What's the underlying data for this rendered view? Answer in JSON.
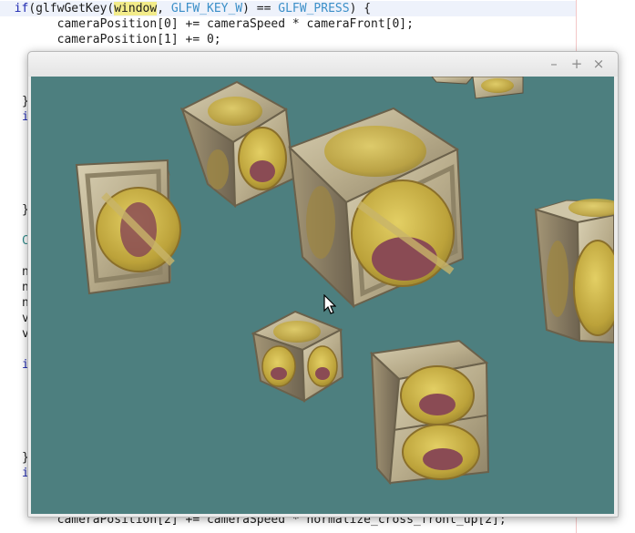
{
  "code": {
    "line1_if": "if",
    "line1_a": "(glfwGetKey(",
    "line1_window": "window",
    "line1_comma": ", ",
    "line1_macro1": "GLFW_KEY_W",
    "line1_eq": ") == ",
    "line1_macro2": "GLFW_PRESS",
    "line1_end": ") {",
    "line2": "cameraPosition[0] += cameraSpeed * cameraFront[0];",
    "line3": "cameraPosition[1] += 0;",
    "last_line": "cameraPosition[2] += cameraSpeed * normalize_cross_front_up[2];",
    "stubs": {
      "s1": "}",
      "s2": "i",
      "s3": "}",
      "s4": "C",
      "s5": "n",
      "s6": "n",
      "s7": "n",
      "s8": "v",
      "s9": "v",
      "s10": "i",
      "s11": "}",
      "s12": "i"
    }
  },
  "window": {
    "title": "",
    "minimize_label": "–",
    "maximize_label": "+",
    "close_label": "×"
  },
  "scene": {
    "background_color": "#4d7f7f",
    "object": "textured crates"
  }
}
